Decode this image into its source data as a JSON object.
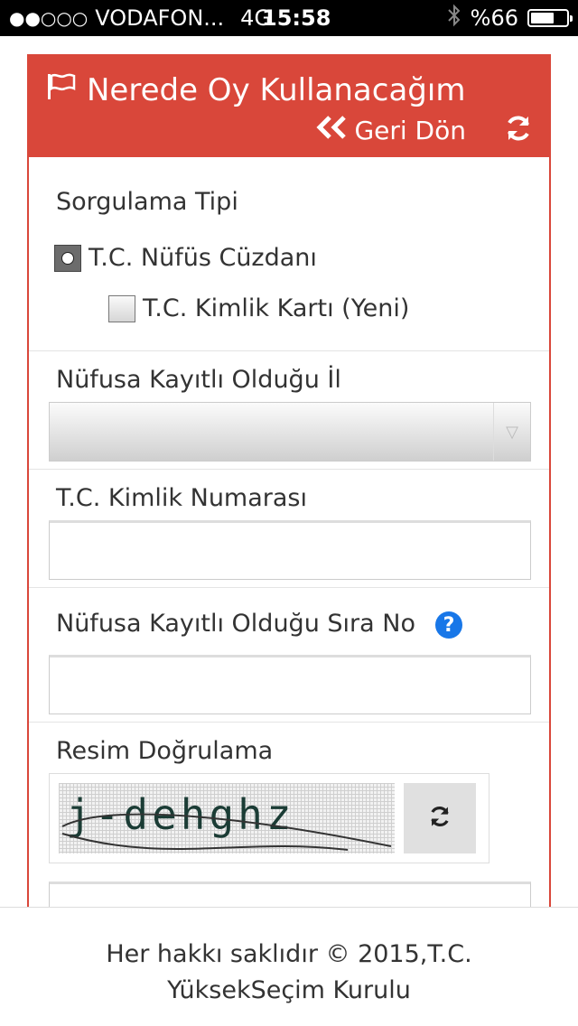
{
  "status_bar": {
    "signal": "●●○○○",
    "carrier": "VODAFON...",
    "network": "4G",
    "time": "15:58",
    "battery_percent": "%66",
    "battery_level": 0.66
  },
  "panel": {
    "title": "Nerede Oy Kullanacağım",
    "back_label": "Geri Dön",
    "accent_color": "#d9473a"
  },
  "query_type": {
    "label": "Sorgulama Tipi",
    "options": [
      {
        "label": "T.C. Nüfüs Cüzdanı",
        "selected": true
      },
      {
        "label": "T.C. Kimlik Kartı (Yeni)",
        "selected": false
      }
    ]
  },
  "province": {
    "label": "Nüfusa Kayıtlı Olduğu İl",
    "selected_value": ""
  },
  "tc_number": {
    "label": "T.C. Kimlik Numarası",
    "value": ""
  },
  "sequence_no": {
    "label": "Nüfusa Kayıtlı Olduğu Sıra No",
    "value": "",
    "help_icon": "question-icon"
  },
  "captcha": {
    "label": "Resim Doğrulama",
    "image_text": "j-dehghz",
    "value": ""
  },
  "footer": {
    "line1": "Her hakkı saklıdır © 2015,T.C.",
    "line2": "YüksekSeçim Kurulu"
  }
}
